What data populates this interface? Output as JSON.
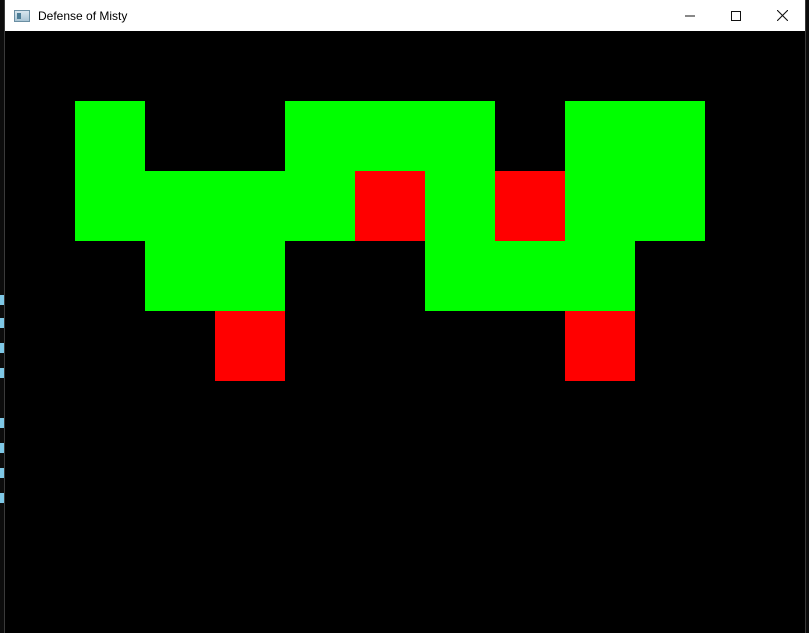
{
  "window": {
    "title": "Defense of Misty",
    "app_icon": "app-window-icon",
    "controls": [
      {
        "name": "minimize-button",
        "icon": "minimize-icon"
      },
      {
        "name": "maximize-button",
        "icon": "maximize-icon"
      },
      {
        "name": "close-button",
        "icon": "close-icon"
      }
    ]
  },
  "colors": {
    "path": "#00ff00",
    "enemy": "#ff0000",
    "background": "#000000"
  },
  "grid": {
    "tile_size_units": 1,
    "path_tiles": [
      [
        1,
        1
      ],
      [
        4,
        1
      ],
      [
        5,
        1
      ],
      [
        6,
        1
      ],
      [
        8,
        1
      ],
      [
        9,
        1
      ],
      [
        1,
        2
      ],
      [
        2,
        2
      ],
      [
        3,
        2
      ],
      [
        4,
        2
      ],
      [
        6,
        2
      ],
      [
        8,
        2
      ],
      [
        9,
        2
      ],
      [
        2,
        3
      ],
      [
        3,
        3
      ],
      [
        6,
        3
      ],
      [
        7,
        3
      ],
      [
        8,
        3
      ]
    ],
    "enemy_tiles": [
      [
        5,
        2
      ],
      [
        7,
        2
      ],
      [
        3,
        4
      ],
      [
        8,
        4
      ]
    ]
  }
}
